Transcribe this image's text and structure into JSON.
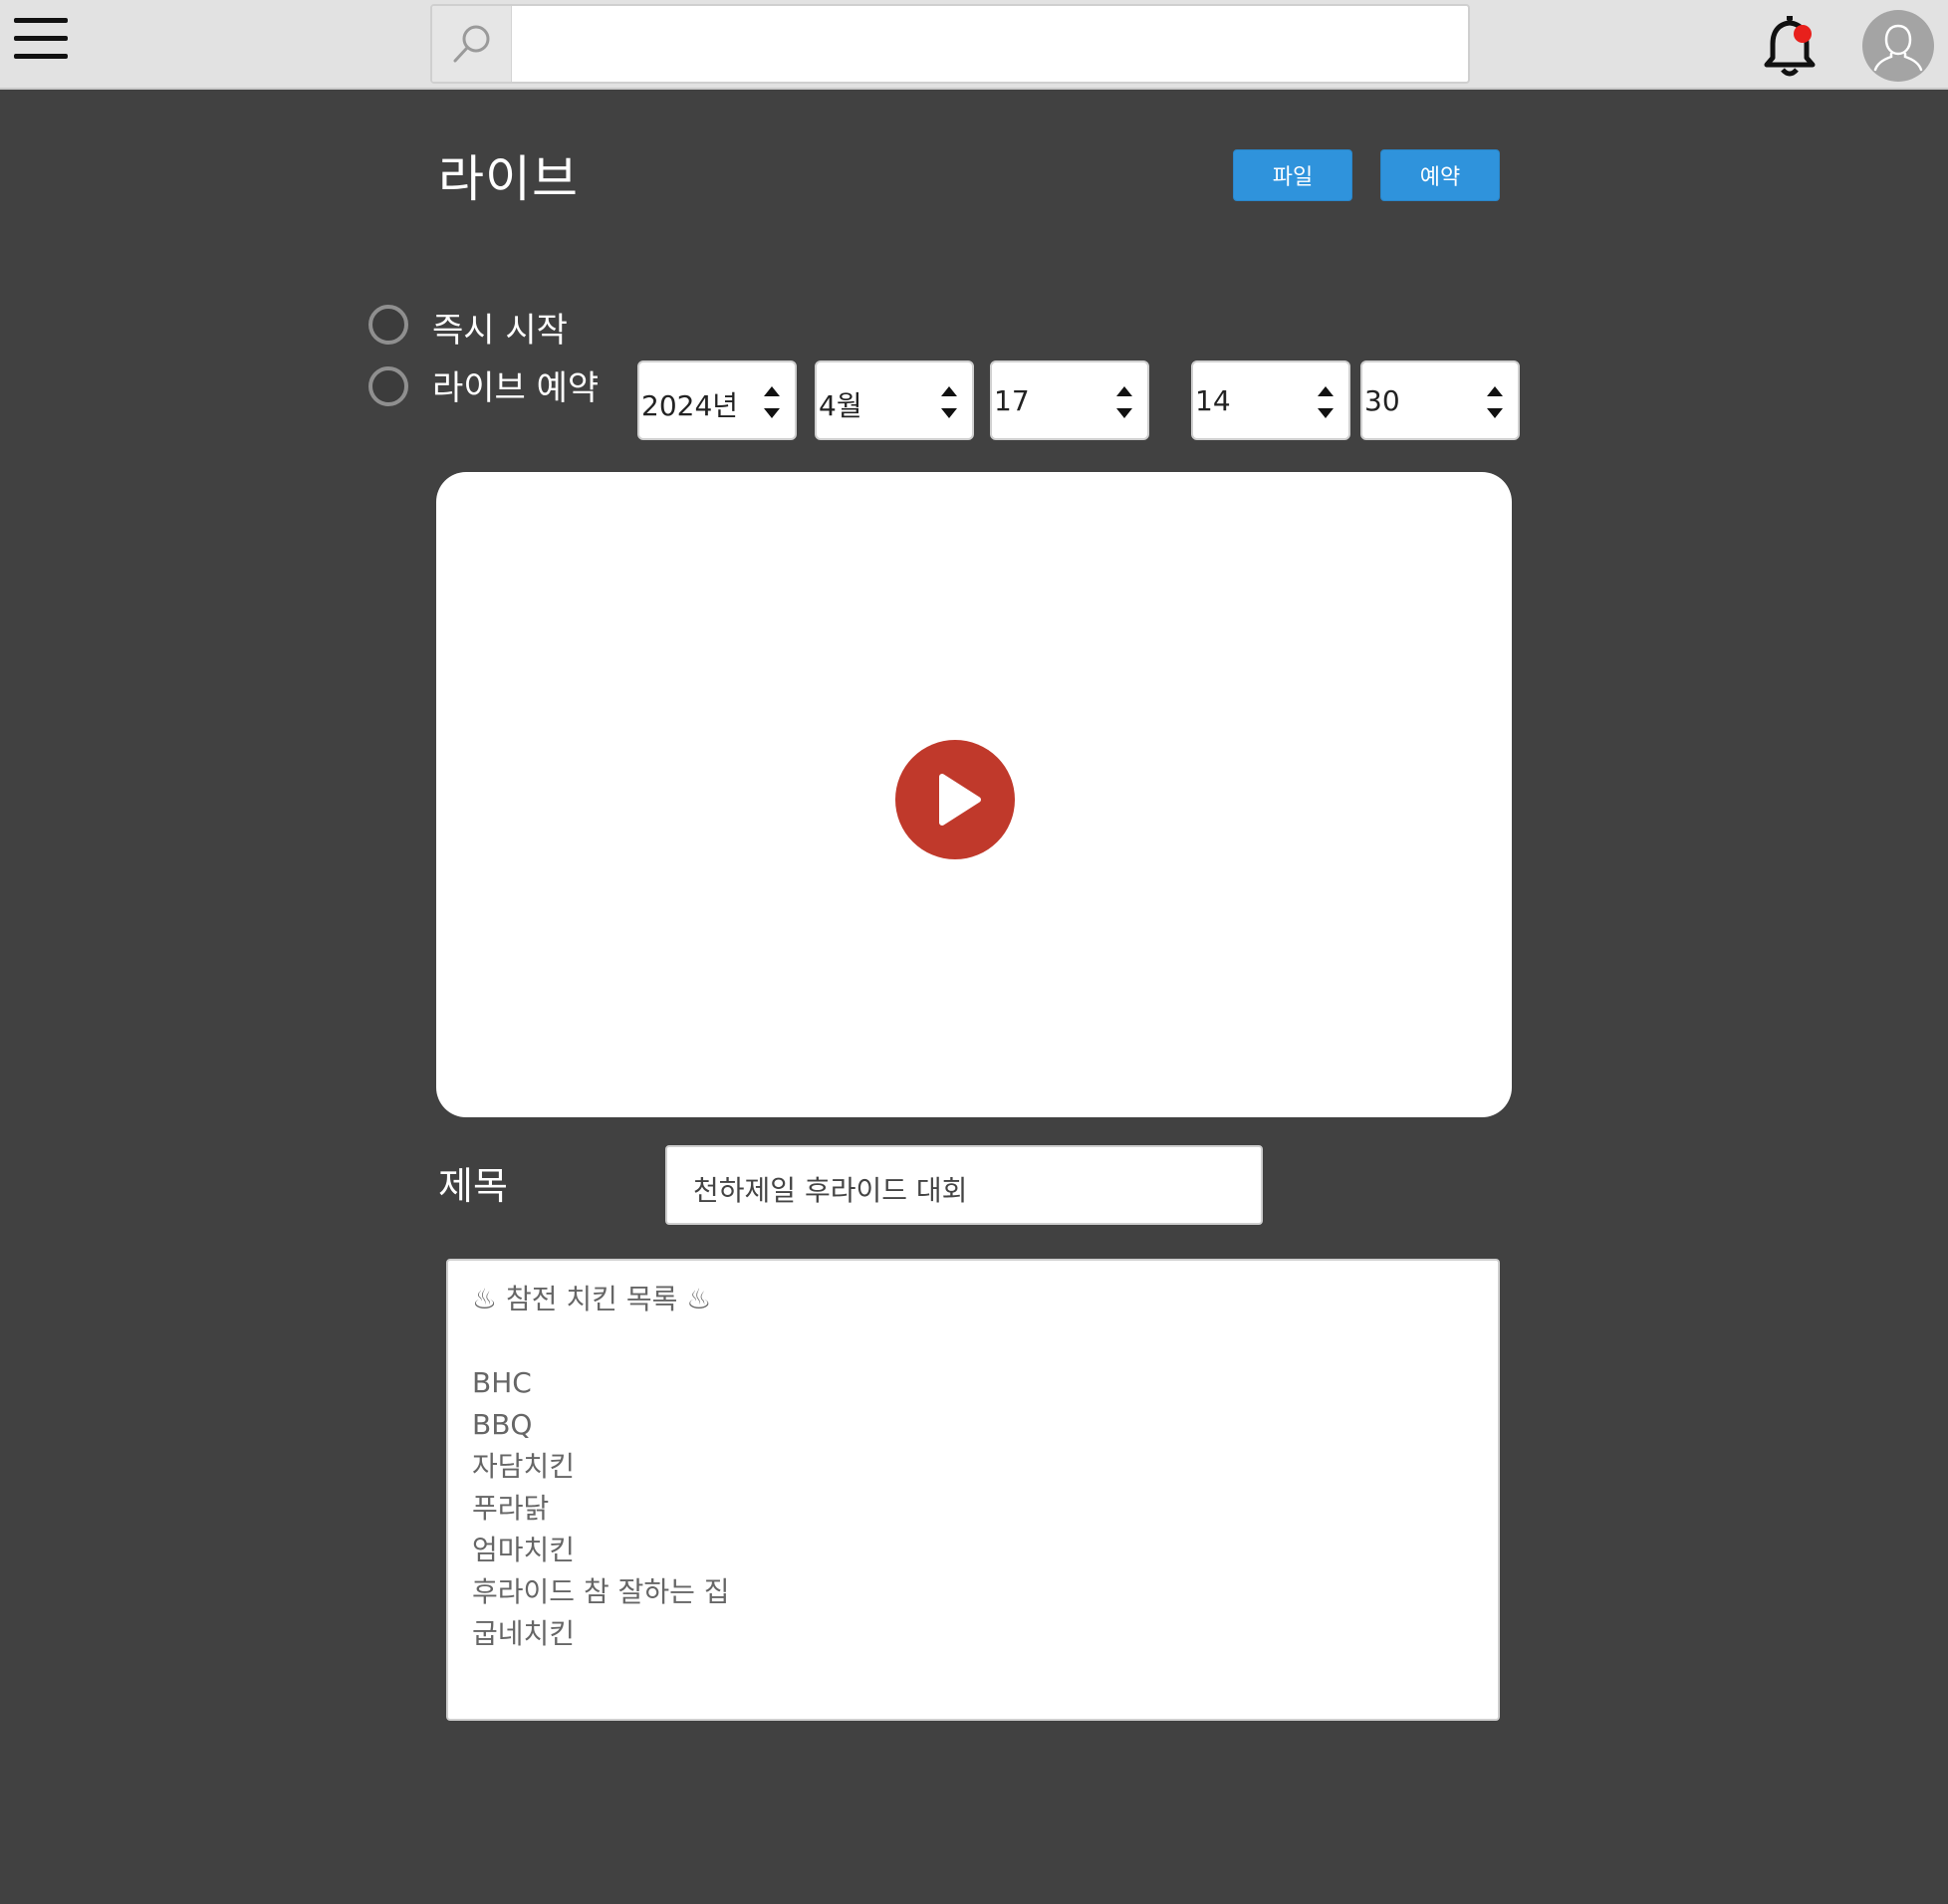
{
  "header": {
    "search": {
      "value": "",
      "placeholder": ""
    }
  },
  "page": {
    "title": "라이브",
    "buttons": {
      "file": "파일",
      "reserve": "예약"
    }
  },
  "schedule": {
    "option_now": "즉시 시작",
    "option_reserve": "라이브 예약",
    "year": "2024년",
    "month": "4월",
    "day": "17",
    "hour": "14",
    "minute": "30"
  },
  "form": {
    "title_label": "제목",
    "title_value": "천하제일 후라이드 대회",
    "description_lines": [
      "♨ 참전 치킨 목록 ♨",
      "",
      "BHC",
      "BBQ",
      "자담치킨",
      "푸라닭",
      "엄마치킨",
      "후라이드 참 잘하는 집",
      "굽네치킨"
    ]
  },
  "colors": {
    "background": "#414141",
    "topbar": "#e2e2e2",
    "button": "#2f93dc",
    "play": "#c0392b",
    "notification_dot": "#e8201c"
  },
  "icons": {
    "menu": "hamburger-menu-icon",
    "search": "search-icon",
    "notification": "bell-icon",
    "profile": "user-avatar-icon",
    "play": "play-icon"
  }
}
